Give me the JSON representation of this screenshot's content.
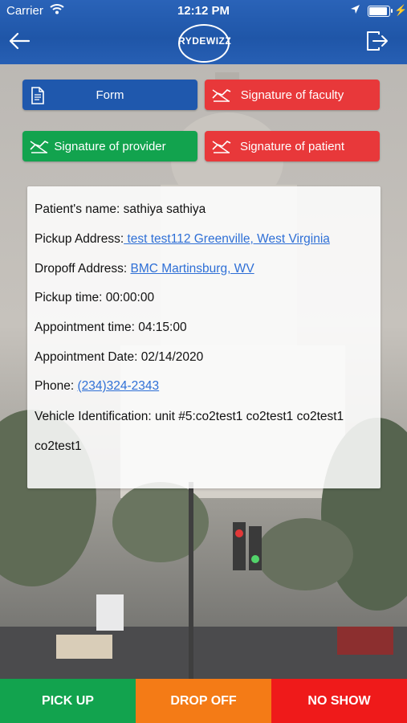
{
  "status_bar": {
    "carrier": "Carrier",
    "time": "12:12 PM"
  },
  "header": {
    "logo_text": "RYDEWIZZ"
  },
  "actions": {
    "form": "Form",
    "signature_faculty": "Signature of faculty",
    "signature_provider": "Signature of provider",
    "signature_patient": "Signature of patient"
  },
  "details": {
    "patient_label": "Patient's name:",
    "patient_value": "sathiya sathiya",
    "pickup_address_label": "Pickup Address:",
    "pickup_address_value": " test test112 Greenville, West Virginia",
    "dropoff_address_label": "Dropoff Address:",
    "dropoff_address_value": "BMC Martinsburg, WV",
    "pickup_time_label": "Pickup time:",
    "pickup_time_value": "00:00:00",
    "appointment_time_label": "Appointment time:",
    "appointment_time_value": "04:15:00",
    "appointment_date_label": "Appointment Date:",
    "appointment_date_value": "02/14/2020",
    "phone_label": "Phone:",
    "phone_value": "(234)324-2343",
    "vehicle_label": "Vehicle Identification:",
    "vehicle_value": " unit #5:co2test1 co2test1 co2test1 co2test1"
  },
  "bottom": {
    "pick_up": "PICK UP",
    "drop_off": "DROP OFF",
    "no_show": "NO SHOW"
  },
  "colors": {
    "header_blue": "#1f56a8",
    "form_blue": "#1f58ad",
    "signature_red": "#e8383a",
    "provider_green": "#12a34e",
    "pickup_green": "#12a34e",
    "dropoff_orange": "#f47b16",
    "noshow_red": "#ef1a1a",
    "link_blue": "#2e6fd6"
  },
  "icons": {
    "back": "arrow-left-icon",
    "logout": "logout-icon",
    "form": "document-icon",
    "signature": "signature-hand-icon",
    "wifi": "wifi-icon",
    "location": "location-arrow-icon",
    "battery": "battery-icon",
    "charging": "bolt-icon"
  }
}
